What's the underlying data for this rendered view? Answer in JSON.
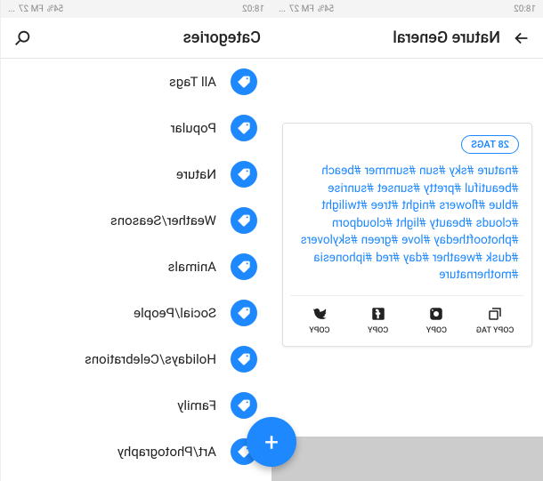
{
  "status": {
    "time": "18:02",
    "network": "FM 27",
    "signal_icons": "54%",
    "dots": "..."
  },
  "right_screen": {
    "title": "Categories",
    "items": [
      {
        "label": "All Tags"
      },
      {
        "label": "Popular"
      },
      {
        "label": "Nature"
      },
      {
        "label": "Weather/Seasons"
      },
      {
        "label": "Animals"
      },
      {
        "label": "Social/People"
      },
      {
        "label": "Holidays/Celebrations"
      },
      {
        "label": "Family"
      },
      {
        "label": "Art/Photography"
      }
    ]
  },
  "left_screen": {
    "title": "Nature General",
    "tag_count": "28 TAGS",
    "hashtags": "#nature #sky #sun #summer #beach #beautiful #pretty #sunset #sunrise #blue #flowers #night #tree #twilight #clouds #beauty #light #cloudporn #photooftheday #love #green #skylovers #dusk #weather #day #red #iphonesia #mothernature",
    "actions": {
      "copy_tag": "COPY TAG",
      "copy_ig": "COPY",
      "copy_fb": "COPY",
      "copy_tw": "COPY"
    }
  },
  "fab": "+"
}
